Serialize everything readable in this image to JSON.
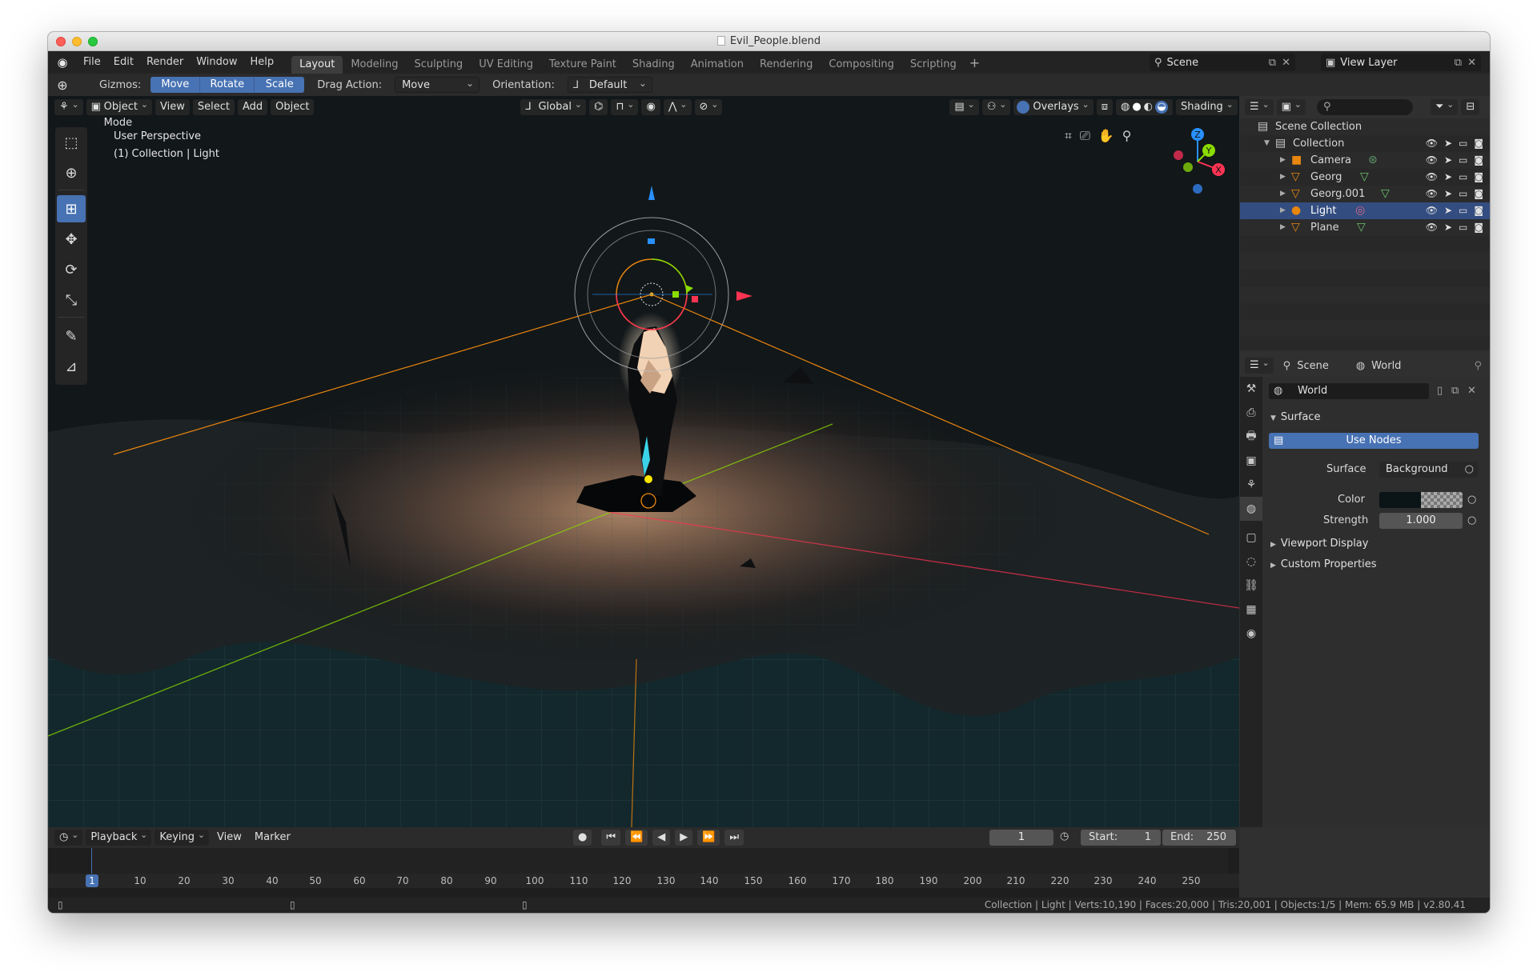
{
  "window": {
    "title": "Evil_People.blend"
  },
  "menu": {
    "items": [
      "File",
      "Edit",
      "Render",
      "Window",
      "Help"
    ]
  },
  "workspaces": [
    "Layout",
    "Modeling",
    "Sculpting",
    "UV Editing",
    "Texture Paint",
    "Shading",
    "Animation",
    "Rendering",
    "Compositing",
    "Scripting"
  ],
  "active_workspace": "Layout",
  "scene_field": "Scene",
  "view_layer_field": "View Layer",
  "toolheader": {
    "gizmos_label": "Gizmos:",
    "gizmo_buttons": [
      "Move",
      "Rotate",
      "Scale"
    ],
    "drag_action_label": "Drag Action:",
    "drag_action_value": "Move",
    "orientation_label": "Orientation:",
    "orientation_value": "Default"
  },
  "viewport": {
    "mode": "Object Mode",
    "menus": [
      "View",
      "Select",
      "Add",
      "Object"
    ],
    "transform_orientation": "Global",
    "overlays_label": "Overlays",
    "shading_label": "Shading",
    "info_line1": "User Perspective",
    "info_line2": "(1) Collection | Light",
    "axis_labels": {
      "x": "X",
      "y": "Y",
      "z": "Z"
    }
  },
  "outliner": {
    "root": "Scene Collection",
    "collection": "Collection",
    "items": [
      {
        "name": "Camera",
        "icon": "camera-icon",
        "selected": false
      },
      {
        "name": "Georg",
        "icon": "mesh-icon",
        "selected": false
      },
      {
        "name": "Georg.001",
        "icon": "mesh-icon",
        "selected": false
      },
      {
        "name": "Light",
        "icon": "light-icon",
        "selected": true
      },
      {
        "name": "Plane",
        "icon": "mesh-icon",
        "selected": false
      }
    ]
  },
  "properties": {
    "breadcrumb_scene": "Scene",
    "breadcrumb_world": "World",
    "world_name": "World",
    "surface_panel": "Surface",
    "use_nodes": "Use Nodes",
    "surface_label": "Surface",
    "surface_value": "Background",
    "color_label": "Color",
    "strength_label": "Strength",
    "strength_value": "1.000",
    "viewport_display": "Viewport Display",
    "custom_properties": "Custom Properties"
  },
  "timeline": {
    "menus": [
      "Playback",
      "Keying",
      "View",
      "Marker"
    ],
    "current_frame": "1",
    "start_label": "Start:",
    "start_value": "1",
    "end_label": "End:",
    "end_value": "250",
    "ticks": [
      "1",
      "10",
      "20",
      "30",
      "40",
      "50",
      "60",
      "70",
      "80",
      "90",
      "100",
      "110",
      "120",
      "130",
      "140",
      "150",
      "160",
      "170",
      "180",
      "190",
      "200",
      "210",
      "220",
      "230",
      "240",
      "250"
    ]
  },
  "statusbar": {
    "text": "Collection | Light | Verts:10,190 | Faces:20,000 | Tris:20,001 | Objects:1/5 | Mem: 65.9 MB | v2.80.41"
  },
  "colors": {
    "accent": "#4772b3",
    "selected_row": "#334d80",
    "x_axis": "#ff3352",
    "y_axis": "#8bdc00",
    "z_axis": "#2890ff",
    "light_orange": "#e8860f"
  }
}
